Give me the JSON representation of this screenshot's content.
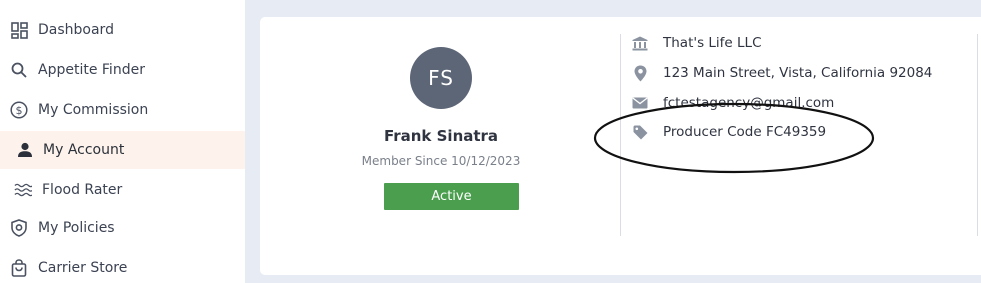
{
  "sidebar": {
    "items": [
      {
        "label": "Dashboard",
        "icon": "dashboard-icon",
        "active": false
      },
      {
        "label": "Appetite Finder",
        "icon": "search-icon",
        "active": false
      },
      {
        "label": "My Commission",
        "icon": "dollar-icon",
        "active": false
      },
      {
        "label": "My Account",
        "icon": "user-icon",
        "active": true
      },
      {
        "label": "Flood Rater",
        "icon": "waves-icon",
        "active": false
      },
      {
        "label": "My Policies",
        "icon": "shield-icon",
        "active": false
      },
      {
        "label": "Carrier Store",
        "icon": "shopping-bag-icon",
        "active": false
      }
    ]
  },
  "profile": {
    "initials": "FS",
    "name": "Frank Sinatra",
    "member_since": "Member Since 10/12/2023",
    "status": "Active"
  },
  "details": {
    "company": "That's Life LLC",
    "address": "123 Main Street, Vista, California 92084",
    "email": "fctestagency@gmail.com",
    "producer_code": "Producer Code FC49359"
  },
  "colors": {
    "sidebar_active_bg": "#fdf3ec",
    "main_bg": "#e7ebf3",
    "avatar_bg": "#5d6677",
    "status_active": "#4a9e4e",
    "icon_gray": "#8b93a1"
  }
}
